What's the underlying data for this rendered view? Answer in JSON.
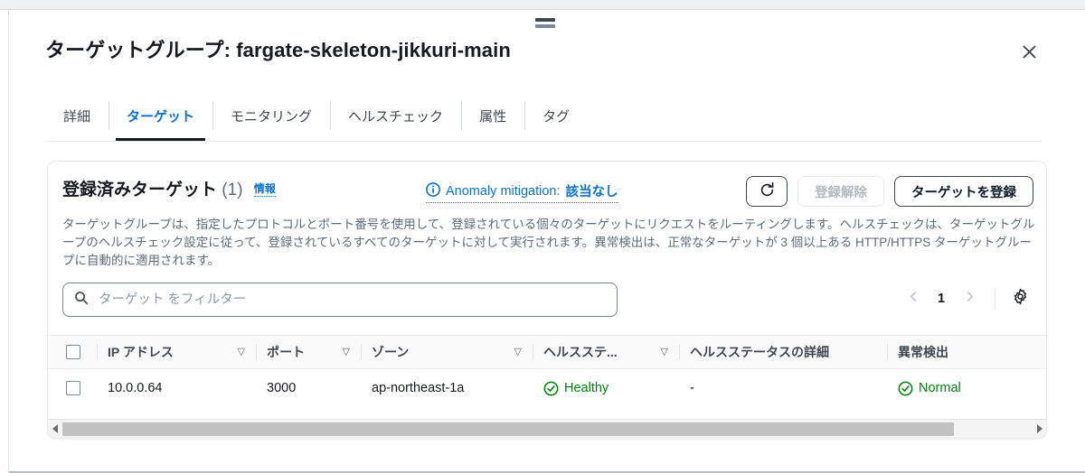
{
  "window": {
    "drag_handle": "drag-handle",
    "close_label": "×"
  },
  "header": {
    "title_label": "ターゲットグループ",
    "title_separator": ": ",
    "title_name": "fargate-skeleton-jikkuri-main"
  },
  "tabs": [
    {
      "label": "詳細",
      "active": false
    },
    {
      "label": "ターゲット",
      "active": true
    },
    {
      "label": "モニタリング",
      "active": false
    },
    {
      "label": "ヘルスチェック",
      "active": false
    },
    {
      "label": "属性",
      "active": false
    },
    {
      "label": "タグ",
      "active": false
    }
  ],
  "panel": {
    "title": "登録済みターゲット",
    "count": "(1)",
    "info_link": "情報",
    "anomaly_mitigation_prefix": "Anomaly mitigation: ",
    "anomaly_mitigation_value": "該当なし",
    "anomaly_icon": "info-circle-icon",
    "refresh_icon": "refresh-icon",
    "deregister_label": "登録解除",
    "register_label": "ターゲットを登録",
    "description": "ターゲットグループは、指定したプロトコルとポート番号を使用して、登録されている個々のターゲットにリクエストをルーティングします。ヘルスチェックは、ターゲットグループのヘルスチェック設定に従って、登録されているすべてのターゲットに対して実行されます。異常検出は、正常なターゲットが 3 個以上ある HTTP/HTTPS ターゲットグループに自動的に適用されます。"
  },
  "search": {
    "icon": "search-icon",
    "placeholder": "ターゲット をフィルター",
    "value": ""
  },
  "pagination": {
    "prev_icon": "chevron-left-icon",
    "page": "1",
    "next_icon": "chevron-right-icon",
    "settings_icon": "gear-icon"
  },
  "table": {
    "columns": [
      {
        "key": "select",
        "label": "",
        "sortable": false
      },
      {
        "key": "ip",
        "label": "IP アドレス",
        "sortable": true,
        "sort_icon": "▽"
      },
      {
        "key": "port",
        "label": "ポート",
        "sortable": true,
        "sort_icon": "▽"
      },
      {
        "key": "zone",
        "label": "ゾーン",
        "sortable": true,
        "sort_icon": "▽"
      },
      {
        "key": "health",
        "label": "ヘルスステ...",
        "sortable": true,
        "sort_icon": "▽"
      },
      {
        "key": "health_detail",
        "label": "ヘルスステータスの詳細",
        "sortable": false
      },
      {
        "key": "anomaly",
        "label": "異常検出",
        "sortable": false
      }
    ],
    "rows": [
      {
        "ip": "10.0.0.64",
        "port": "3000",
        "zone": "ap-northeast-1a",
        "health": "Healthy",
        "health_icon": "check-circle-icon",
        "health_detail": "-",
        "anomaly": "Normal",
        "anomaly_icon": "check-circle-icon"
      }
    ]
  },
  "scrollbar": {
    "left_arrow": "◀",
    "right_arrow": "▶",
    "thumb_percent": "92"
  },
  "colors": {
    "link": "#0972d3",
    "success": "#037f0c",
    "text": "#16191f",
    "muted": "#5f6b7a",
    "border": "#e9ebed",
    "header_bg": "#fafafa"
  }
}
